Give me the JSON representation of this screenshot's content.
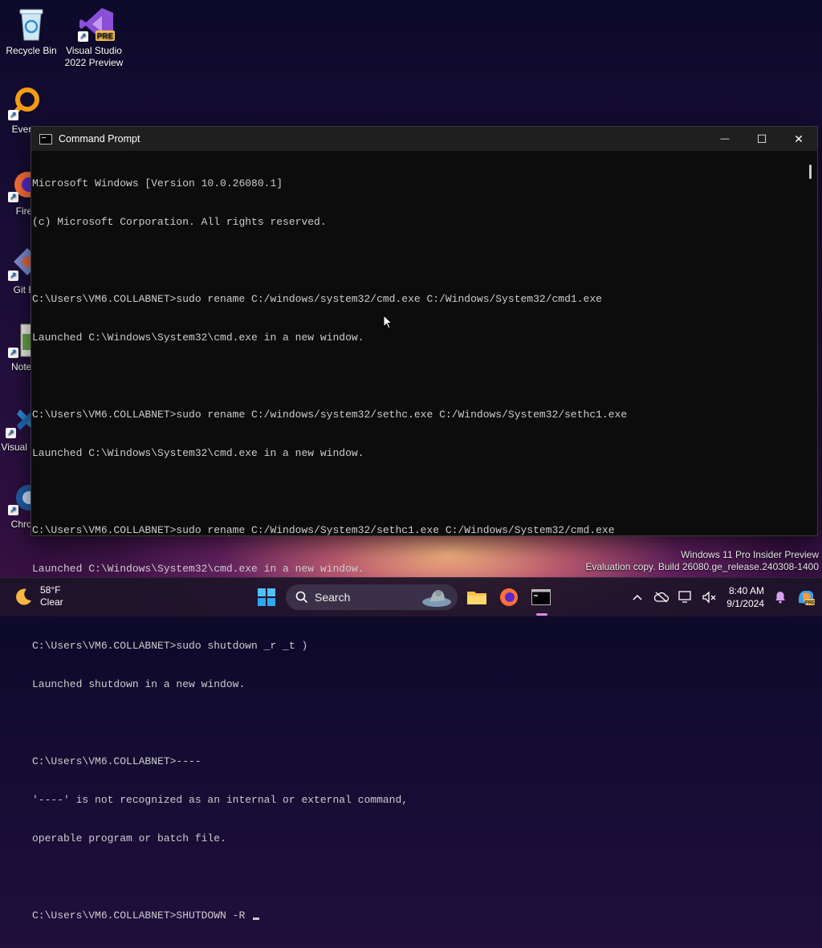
{
  "desktop": {
    "icons": [
      {
        "label": "Recycle Bin"
      },
      {
        "label": "Visual Studio 2022 Preview",
        "badge": "PRE"
      },
      {
        "label": "Every"
      },
      {
        "label": "Fire"
      },
      {
        "label": "Git B"
      },
      {
        "label": "Notep"
      },
      {
        "label": "Visual Co"
      },
      {
        "label": "Chron"
      }
    ]
  },
  "window": {
    "title": "Command Prompt",
    "controls": {
      "minimize": "—",
      "maximize": "☐",
      "close": "✕"
    },
    "console_lines": [
      "Microsoft Windows [Version 10.0.26080.1]",
      "(c) Microsoft Corporation. All rights reserved.",
      "",
      "C:\\Users\\VM6.COLLABNET>sudo rename C:/windows/system32/cmd.exe C:/Windows/System32/cmd1.exe",
      "Launched C:\\Windows\\System32\\cmd.exe in a new window.",
      "",
      "C:\\Users\\VM6.COLLABNET>sudo rename C:/windows/system32/sethc.exe C:/Windows/System32/sethc1.exe",
      "Launched C:\\Windows\\System32\\cmd.exe in a new window.",
      "",
      "C:\\Users\\VM6.COLLABNET>sudo rename C:/Windows/System32/sethc1.exe C:/Windows/System32/cmd.exe",
      "Launched C:\\Windows\\System32\\cmd.exe in a new window.",
      "",
      "C:\\Users\\VM6.COLLABNET>sudo shutdown _r _t )",
      "Launched shutdown in a new window.",
      "",
      "C:\\Users\\VM6.COLLABNET>----",
      "'----' is not recognized as an internal or external command,",
      "operable program or batch file.",
      "",
      "C:\\Users\\VM6.COLLABNET>SHUTDOWN -R "
    ]
  },
  "watermark": {
    "line1": "Windows 11 Pro Insider Preview",
    "line2": "Evaluation copy. Build 26080.ge_release.240308-1400"
  },
  "taskbar": {
    "weather": {
      "temp": "58°F",
      "condition": "Clear"
    },
    "search_label": "Search",
    "clock": {
      "time": "8:40 AM",
      "date": "9/1/2024"
    }
  },
  "colors": {
    "accent": "#d58be0",
    "console_bg": "#0c0c0c",
    "console_fg": "#cccccc"
  }
}
